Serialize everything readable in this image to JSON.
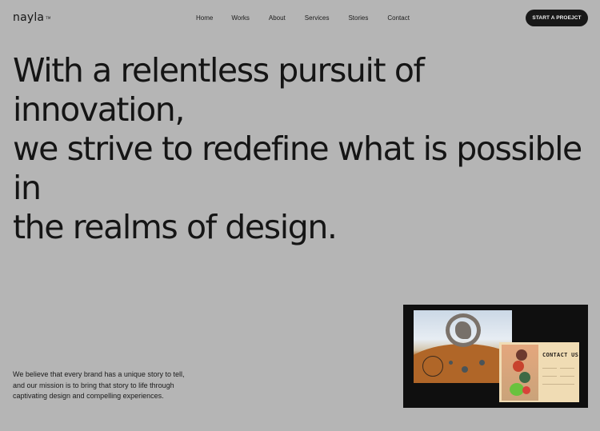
{
  "brand": {
    "name": "nayla",
    "mark": "TM"
  },
  "nav": {
    "items": [
      {
        "label": "Home"
      },
      {
        "label": "Works"
      },
      {
        "label": "About"
      },
      {
        "label": "Services"
      },
      {
        "label": "Stories"
      },
      {
        "label": "Contact"
      }
    ]
  },
  "cta": {
    "label": "START A PROEJCT"
  },
  "hero": {
    "lines": [
      "With a relentless pursuit of innovation,",
      "we strive to redefine what is possible in",
      "the realms of design."
    ]
  },
  "intro": {
    "lines": [
      "We believe that every brand has a unique story to tell,",
      "and our mission is to bring that story to life through",
      "captivating design and compelling experiences."
    ]
  },
  "preview": {
    "card_title": "CONTACT US"
  },
  "colors": {
    "background": "#b5b5b5",
    "text": "#151515",
    "button": "#181818"
  }
}
